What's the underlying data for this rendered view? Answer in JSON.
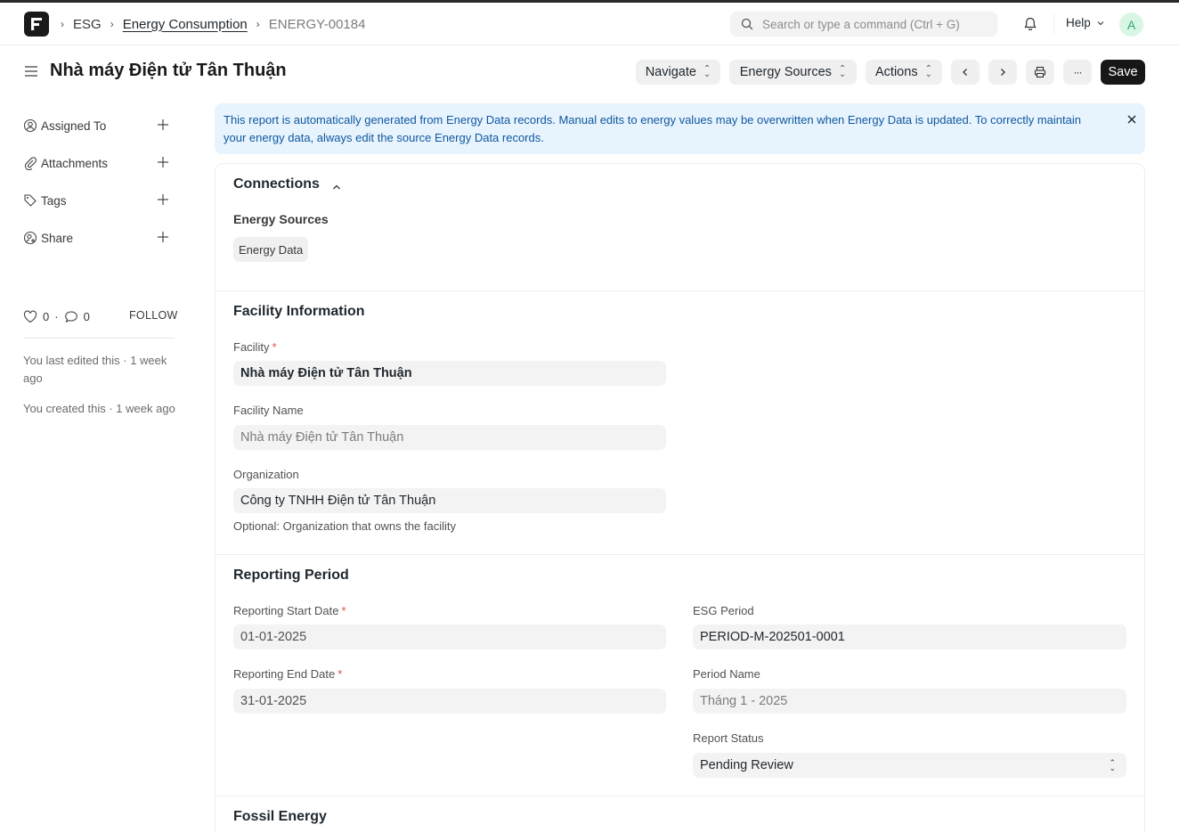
{
  "navbar": {
    "breadcrumbs": [
      "ESG",
      "Energy Consumption",
      "ENERGY-00184"
    ],
    "search_placeholder": "Search or type a command (Ctrl + G)",
    "help_label": "Help",
    "avatar_initial": "A"
  },
  "page": {
    "title": "Nhà máy Điện tử Tân Thuận",
    "buttons": {
      "navigate": "Navigate",
      "energy_sources": "Energy Sources",
      "actions": "Actions",
      "more": "···",
      "save": "Save"
    }
  },
  "sidebar": {
    "items": [
      {
        "label": "Assigned To",
        "icon": "assign-icon"
      },
      {
        "label": "Attachments",
        "icon": "paperclip-icon"
      },
      {
        "label": "Tags",
        "icon": "tag-icon"
      },
      {
        "label": "Share",
        "icon": "share-icon"
      }
    ],
    "likes_count": "0",
    "comments_count": "0",
    "follow_label": "FOLLOW",
    "last_edited": "You last edited this · 1 week ago",
    "created": "You created this · 1 week ago"
  },
  "alert": {
    "text": "This report is automatically generated from Energy Data records. Manual edits to energy values may be overwritten when Energy Data is updated. To correctly maintain your energy data, always edit the source Energy Data records."
  },
  "connections": {
    "title": "Connections",
    "group_label": "Energy Sources",
    "links": [
      "Energy Data"
    ]
  },
  "facility": {
    "title": "Facility Information",
    "facility_label": "Facility",
    "facility_value": "Nhà máy Điện tử Tân Thuận",
    "facility_name_label": "Facility Name",
    "facility_name_value": "Nhà máy Điện tử Tân Thuận",
    "organization_label": "Organization",
    "organization_value": "Công ty TNHH Điện tử Tân Thuận",
    "organization_hint": "Optional: Organization that owns the facility"
  },
  "reporting": {
    "title": "Reporting Period",
    "start_label": "Reporting Start Date",
    "start_value": "01-01-2025",
    "end_label": "Reporting End Date",
    "end_value": "31-01-2025",
    "esg_period_label": "ESG Period",
    "esg_period_value": "PERIOD-M-202501-0001",
    "period_name_label": "Period Name",
    "period_name_value": "Tháng 1 - 2025",
    "status_label": "Report Status",
    "status_value": "Pending Review"
  },
  "fossil": {
    "title": "Fossil Energy"
  },
  "colors": {
    "primary_button": "#171717",
    "alert_bg": "#e8f4fd",
    "alert_text": "#0f57a0",
    "required": "#e24c4c"
  }
}
